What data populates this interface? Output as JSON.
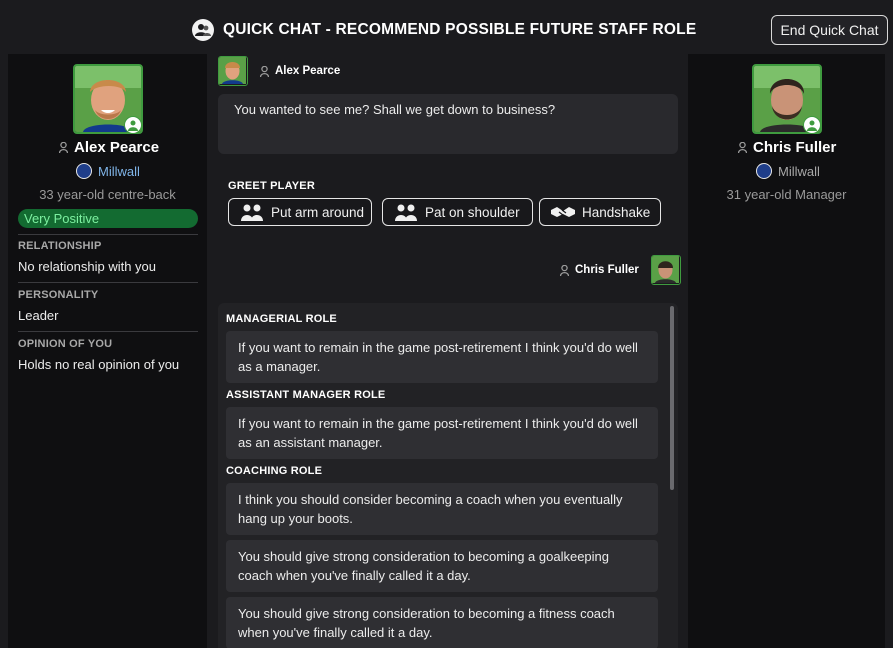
{
  "header": {
    "title": "QUICK CHAT - RECOMMEND POSSIBLE FUTURE STAFF ROLE",
    "end_button": "End Quick Chat"
  },
  "player": {
    "name": "Alex Pearce",
    "club": "Millwall",
    "description": "33 year-old centre-back",
    "status": "Very Positive",
    "sections": [
      {
        "label": "RELATIONSHIP",
        "value": "No relationship with you"
      },
      {
        "label": "PERSONALITY",
        "value": "Leader"
      },
      {
        "label": "OPINION OF YOU",
        "value": "Holds no real opinion of you"
      }
    ]
  },
  "manager": {
    "name": "Chris Fuller",
    "club": "Millwall",
    "description": "31 year-old Manager"
  },
  "conversation": {
    "player_name": "Alex Pearce",
    "player_message": "You wanted to see me? Shall we get down to business?",
    "greet_label": "GREET PLAYER",
    "greet_options": [
      "Put arm around",
      "Pat on shoulder",
      "Handshake"
    ],
    "manager_name": "Chris Fuller"
  },
  "options": {
    "groups": [
      {
        "label": "MANAGERIAL ROLE",
        "items": [
          "If you want to remain in the game post-retirement I think you'd do well as a manager."
        ]
      },
      {
        "label": "ASSISTANT MANAGER ROLE",
        "items": [
          "If you want to remain in the game post-retirement I think you'd do well as an assistant manager."
        ]
      },
      {
        "label": "COACHING ROLE",
        "items": [
          "I think you should consider becoming a coach when you eventually hang up your boots.",
          "You should give strong consideration to becoming a goalkeeping coach when you've finally called it a day.",
          "You should give strong consideration to becoming a fitness coach when you've finally called it a day."
        ]
      }
    ]
  },
  "colors": {
    "background": "#1b1b1e",
    "panel": "#0f0f11",
    "status_pill": "#136b31",
    "status_text": "#7cf0a0",
    "club_text": "#7fb4e8",
    "avatar_border": "#3f9b3f"
  },
  "icons": {
    "title": "chat-heads-icon",
    "person": "person-icon",
    "club": "millwall-lion-icon",
    "greet": [
      "hug-icon",
      "pat-shoulder-icon",
      "handshake-icon"
    ]
  }
}
